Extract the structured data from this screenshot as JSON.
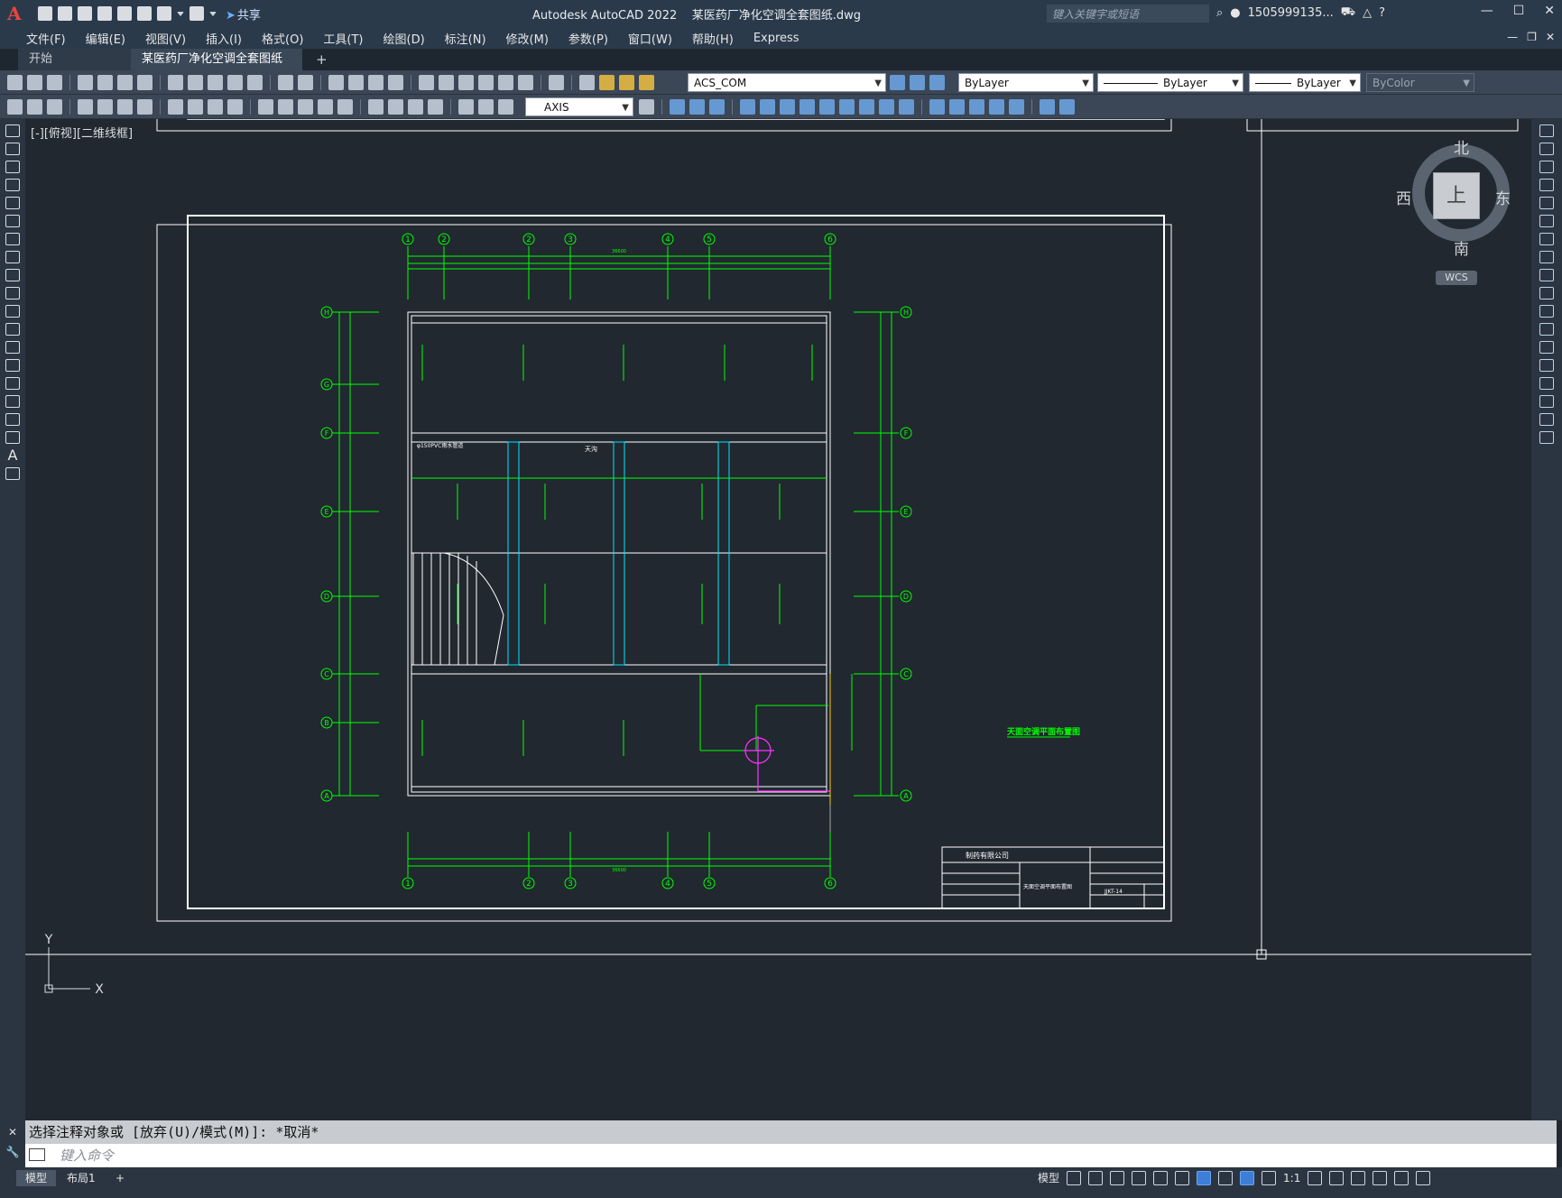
{
  "window": {
    "app_title": "Autodesk AutoCAD 2022",
    "file_title": "某医药厂净化空调全套图纸.dwg",
    "search_placeholder": "键入关键字或短语",
    "user": "1505999135...",
    "share_label": "共享"
  },
  "menu": [
    "文件(F)",
    "编辑(E)",
    "视图(V)",
    "插入(I)",
    "格式(O)",
    "工具(T)",
    "绘图(D)",
    "标注(N)",
    "修改(M)",
    "参数(P)",
    "窗口(W)",
    "帮助(H)",
    "Express"
  ],
  "tabs": {
    "start": "开始",
    "active": "某医药厂净化空调全套图纸*"
  },
  "toolbar": {
    "layer_combo": "ACS_COM",
    "color_combo": "ByLayer",
    "linetype_combo": "ByLayer",
    "lineweight_combo": "ByLayer",
    "plotstyle_combo": "ByColor",
    "textstyle_combo": "AXIS"
  },
  "viewport_label": "[-][俯视][二维线框]",
  "navcube": {
    "north": "北",
    "south": "南",
    "east": "东",
    "west": "西",
    "face": "上",
    "wcs": "WCS"
  },
  "drawing": {
    "title": "天面空调平面布置图",
    "company": "制药有限公司",
    "sheet_no": "JJKT-14",
    "axis_top": [
      "1",
      "2",
      "2",
      "3",
      "4",
      "5",
      "6"
    ],
    "axis_bottom": [
      "1",
      "2",
      "3",
      "4",
      "5",
      "6"
    ],
    "axis_side": [
      "H",
      "G",
      "F",
      "E",
      "D",
      "C",
      "B",
      "A"
    ],
    "dim_total": "36600",
    "label_tiangou": "天沟",
    "label_pipe": "φ150PVC雨水管道"
  },
  "ucs": {
    "x": "X",
    "y": "Y"
  },
  "command": {
    "history": "选择注释对象或 [放弃(U)/模式(M)]: *取消*",
    "input_placeholder": "键入命令"
  },
  "status": {
    "model_tab": "模型",
    "layout_tab": "布局1",
    "model_label": "模型",
    "scale": "1:1"
  }
}
